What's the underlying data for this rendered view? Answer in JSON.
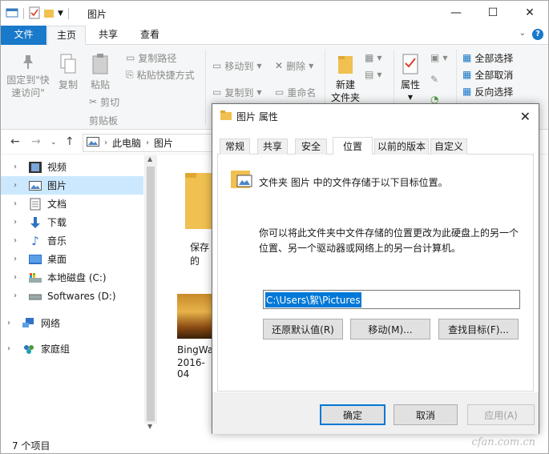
{
  "window": {
    "title": "图片"
  },
  "window_controls": {
    "minimize": "—",
    "maximize": "☐",
    "close": "✕"
  },
  "ribbon_tabs": [
    "文件",
    "主页",
    "共享",
    "查看"
  ],
  "ribbon": {
    "pin": "固定到\"快\n速访问\"",
    "copy": "复制",
    "paste": "粘贴",
    "copy_path": "复制路径",
    "paste_shortcut": "粘贴快捷方式",
    "cut": "剪切",
    "clipboard_group": "剪贴板",
    "move_to": "移动到",
    "copy_to": "复制到",
    "delete": "删除",
    "rename": "重命名",
    "new_folder": "新建\n文件夹",
    "properties": "属性",
    "select_all": "全部选择",
    "select_none": "全部取消",
    "invert_selection": "反向选择"
  },
  "address": {
    "crumbs": [
      "此电脑",
      "图片"
    ]
  },
  "nav": [
    {
      "label": "视频",
      "icon": "video-folder-icon"
    },
    {
      "label": "图片",
      "icon": "pictures-folder-icon",
      "selected": true
    },
    {
      "label": "文档",
      "icon": "documents-folder-icon"
    },
    {
      "label": "下载",
      "icon": "downloads-folder-icon"
    },
    {
      "label": "音乐",
      "icon": "music-folder-icon"
    },
    {
      "label": "桌面",
      "icon": "desktop-folder-icon"
    },
    {
      "label": "本地磁盘 (C:)",
      "icon": "local-disk-icon"
    },
    {
      "label": "Softwares (D:)",
      "icon": "drive-icon"
    },
    {
      "label": "网络",
      "icon": "network-icon"
    },
    {
      "label": "家庭组",
      "icon": "homegroup-icon"
    }
  ],
  "content": {
    "folder_label": "保存的",
    "file_label_1": "BingWa",
    "file_label_2": "2016-04"
  },
  "status": {
    "items": "7 个项目"
  },
  "watermark": "cfan.com.cn",
  "dialog": {
    "title": "图片 属性",
    "tabs": [
      "常规",
      "共享",
      "安全",
      "位置",
      "以前的版本",
      "自定义"
    ],
    "active_tab": "位置",
    "intro": "文件夹 图片 中的文件存储于以下目标位置。",
    "desc_line1": "你可以将此文件夹中文件存储的位置更改为此硬盘上的另一个",
    "desc_line2": "位置、另一个驱动器或网络上的另一台计算机。",
    "path": "C:\\Users\\絮\\Pictures",
    "restore_btn": "还原默认值(R)",
    "move_btn": "移动(M)...",
    "find_btn": "查找目标(F)...",
    "ok": "确定",
    "cancel": "取消",
    "apply": "应用(A)"
  },
  "colors": {
    "accent": "#1979ca",
    "selection": "#cce8ff",
    "dialog_default": "#0078d7",
    "folder": "#f0c050"
  }
}
